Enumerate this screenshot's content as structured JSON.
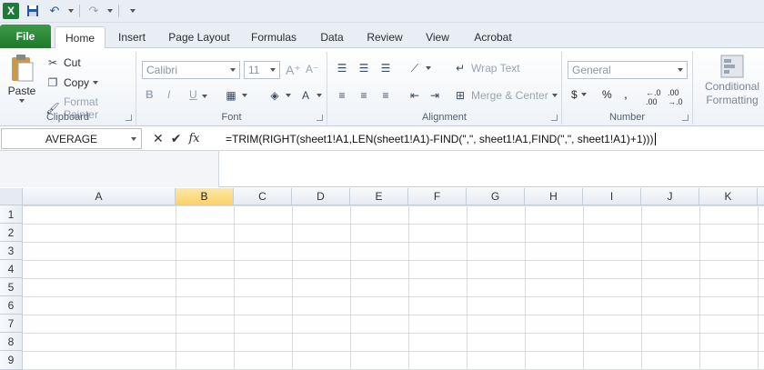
{
  "qat": {
    "app_icon_letter": "X",
    "icons": [
      "save-icon",
      "undo-icon",
      "redo-icon",
      "customize-icon"
    ]
  },
  "tabs": [
    {
      "label": "File",
      "id": "file"
    },
    {
      "label": "Home",
      "id": "home",
      "active": true
    },
    {
      "label": "Insert",
      "id": "insert"
    },
    {
      "label": "Page Layout",
      "id": "page-layout"
    },
    {
      "label": "Formulas",
      "id": "formulas"
    },
    {
      "label": "Data",
      "id": "data"
    },
    {
      "label": "Review",
      "id": "review"
    },
    {
      "label": "View",
      "id": "view"
    },
    {
      "label": "Acrobat",
      "id": "acrobat"
    }
  ],
  "ribbon": {
    "clipboard": {
      "label": "Clipboard",
      "paste": "Paste",
      "cut": "Cut",
      "copy": "Copy",
      "format_painter": "Format Painter"
    },
    "font": {
      "label": "Font",
      "font_name": "Calibri",
      "font_size": "11",
      "bold": "B",
      "italic": "I",
      "underline": "U"
    },
    "alignment": {
      "label": "Alignment",
      "wrap_text": "Wrap Text",
      "merge_center": "Merge & Center"
    },
    "number": {
      "label": "Number",
      "format": "General",
      "currency": "$",
      "percent": "%",
      "comma": ","
    },
    "styles": {
      "conditional_formatting_1": "Conditional",
      "conditional_formatting_2": "Formatting"
    }
  },
  "formula_bar": {
    "name_box": "AVERAGE",
    "cancel": "✕",
    "enter": "✔",
    "fx": "fx",
    "formula": "=TRIM(RIGHT(sheet1!A1,LEN(sheet1!A1)-FIND(\",\", sheet1!A1,FIND(\",\", sheet1!A1)+1)))"
  },
  "grid": {
    "columns": [
      "A",
      "B",
      "C",
      "D",
      "E",
      "F",
      "G",
      "H",
      "I",
      "J",
      "K"
    ],
    "selected_column": "B",
    "rows": [
      "1",
      "2",
      "3",
      "4",
      "5",
      "6",
      "7",
      "8",
      "9"
    ]
  },
  "colors": {
    "file_tab": "#1f7a2d",
    "selected_header": "#f9d26a",
    "ribbon_bg": "#eef2f7"
  }
}
